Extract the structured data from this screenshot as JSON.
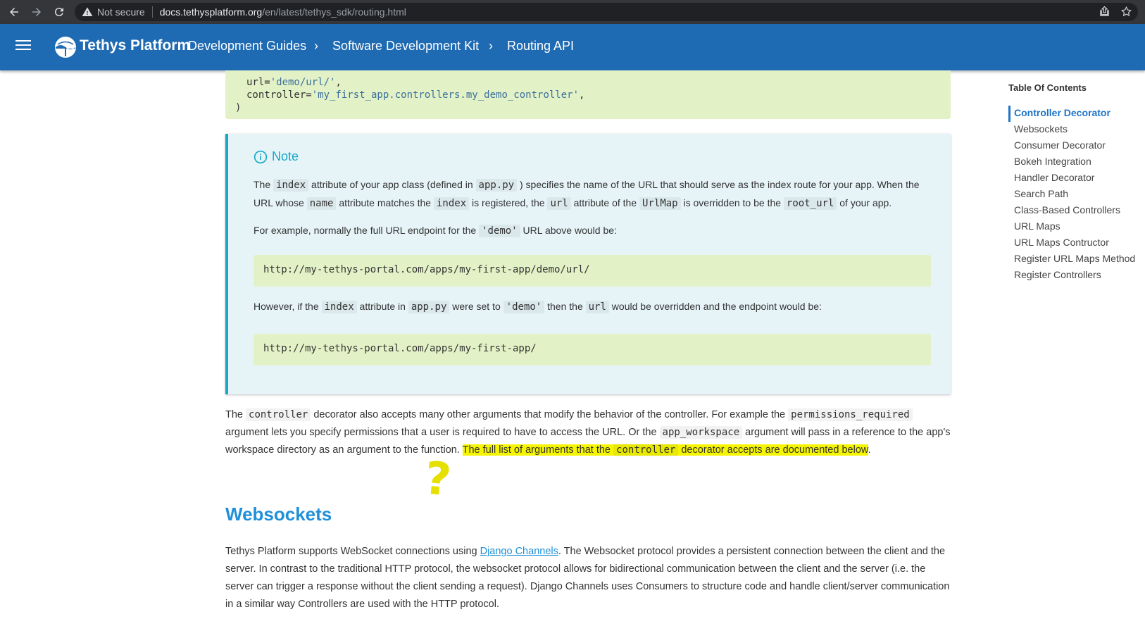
{
  "browser": {
    "not_secure": "Not secure",
    "url_host": "docs.tethysplatform.org",
    "url_path": "/en/latest/tethys_sdk/routing.html"
  },
  "header": {
    "brand": "Tethys Platform",
    "breadcrumbs": [
      "Development Guides",
      "Software Development Kit",
      "Routing API"
    ],
    "color": "#1e6ab3"
  },
  "code_top": {
    "line1_prefix": "url=",
    "line1_str": "'demo/url/'",
    "line1_suffix": ",",
    "line2_prefix": "controller=",
    "line2_str": "'my_first_app.controllers.my_demo_controller'",
    "line2_suffix": ",",
    "line3": ")"
  },
  "note": {
    "title": "Note",
    "p1": {
      "t1": "The ",
      "c1": "index",
      "t2": " attribute of your app class (defined in ",
      "c2": "app.py",
      "t3": " ) specifies the name of the URL that should serve as the index route for your app. When the URL whose ",
      "c3": "name",
      "t4": " attribute matches the ",
      "c4": "index",
      "t5": " is registered, the ",
      "c5": "url",
      "t6": " attribute of the ",
      "c6": "UrlMap",
      "t7": " is overridden to be the ",
      "c7": "root_url",
      "t8": " of your app."
    },
    "p2": {
      "t1": "For example, normally the full URL endpoint for the ",
      "c1": "'demo'",
      "t2": " URL above would be:"
    },
    "code1": "http://my-tethys-portal.com/apps/my-first-app/demo/url/",
    "p3": {
      "t1": "However, if the ",
      "c1": "index",
      "t2": " attribute in ",
      "c2": "app.py",
      "t3": " were set to ",
      "c3": "'demo'",
      "t4": " then the ",
      "c4": "url",
      "t5": " would be overridden and the endpoint would be:"
    },
    "code2": "http://my-tethys-portal.com/apps/my-first-app/"
  },
  "para1": {
    "t1": "The ",
    "c1": "controller",
    "t2": " decorator also accepts many other arguments that modify the behavior of the controller. For example the ",
    "c2": "permissions_required",
    "t3": " argument lets you specify permissions that a user is required to have to access the URL. Or the ",
    "c3": "app_workspace",
    "t4": " argument will pass in a reference to the app's workspace directory as an argument to the function. ",
    "h1": "The full list of arguments that the ",
    "hc": "controller",
    "h2": " decorator accepts are documented below",
    "t5": "."
  },
  "annotation": "?",
  "section": {
    "heading": "Websockets",
    "p": {
      "t1": "Tethys Platform supports WebSocket connections using ",
      "link": "Django Channels",
      "t2": ". The Websocket protocol provides a persistent connection between the client and the server. In contrast to the traditional HTTP protocol, the websocket protocol allows for bidirectional communication between the client and the server (i.e. the server can trigger a response without the client sending a request). Django Channels uses Consumers to structure code and handle client/server communication in a similar way Controllers are used with the HTTP protocol."
    }
  },
  "toc": {
    "title": "Table Of Contents",
    "items": [
      "Controller Decorator",
      "Websockets",
      "Consumer Decorator",
      "Bokeh Integration",
      "Handler Decorator",
      "Search Path",
      "Class-Based Controllers",
      "URL Maps",
      "URL Maps Contructor",
      "Register URL Maps Method",
      "Register Controllers"
    ]
  }
}
